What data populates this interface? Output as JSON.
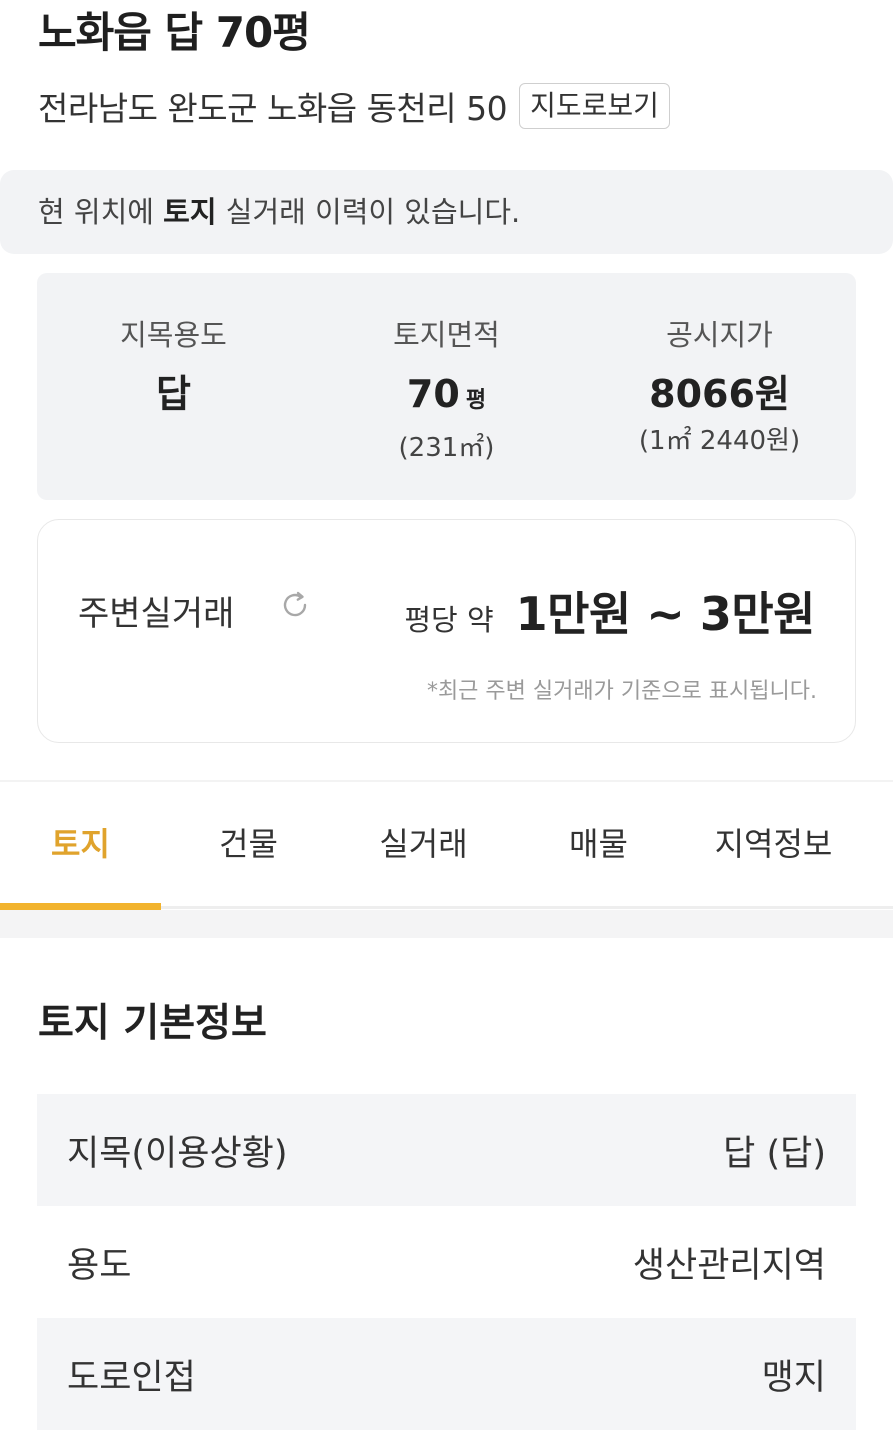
{
  "header": {
    "title": "노화읍 답 70평",
    "address": "전라남도 완도군 노화읍 동천리 50",
    "map_button": "지도로보기"
  },
  "notice": {
    "prefix": "현 위치에 ",
    "highlight": "토지",
    "suffix": " 실거래 이력이 있습니다."
  },
  "summary": [
    {
      "label": "지목용도",
      "value": "답",
      "unit": "",
      "sub": ""
    },
    {
      "label": "토지면적",
      "value": "70",
      "unit": "평",
      "sub": "(231㎡)"
    },
    {
      "label": "공시지가",
      "value": "8066원",
      "unit": "",
      "sub": "(1㎡ 2440원)"
    }
  ],
  "nearby": {
    "title": "주변실거래",
    "price_prefix": "평당 약",
    "price_range": "1만원 ~ 3만원",
    "note": "*최근 주변 실거래가 기준으로 표시됩니다."
  },
  "tabs": [
    {
      "label": "토지",
      "active": true
    },
    {
      "label": "건물",
      "active": false
    },
    {
      "label": "실거래",
      "active": false
    },
    {
      "label": "매물",
      "active": false
    },
    {
      "label": "지역정보",
      "active": false
    }
  ],
  "basic_info": {
    "title": "토지 기본정보",
    "rows": [
      {
        "label": "지목(이용상황)",
        "value": "답 (답)"
      },
      {
        "label": "용도",
        "value": "생산관리지역"
      },
      {
        "label": "도로인접",
        "value": "맹지"
      }
    ]
  },
  "colors": {
    "accent": "#f2b32e",
    "active_tab_text": "#e0a32c",
    "panel_bg": "#f2f3f5"
  }
}
